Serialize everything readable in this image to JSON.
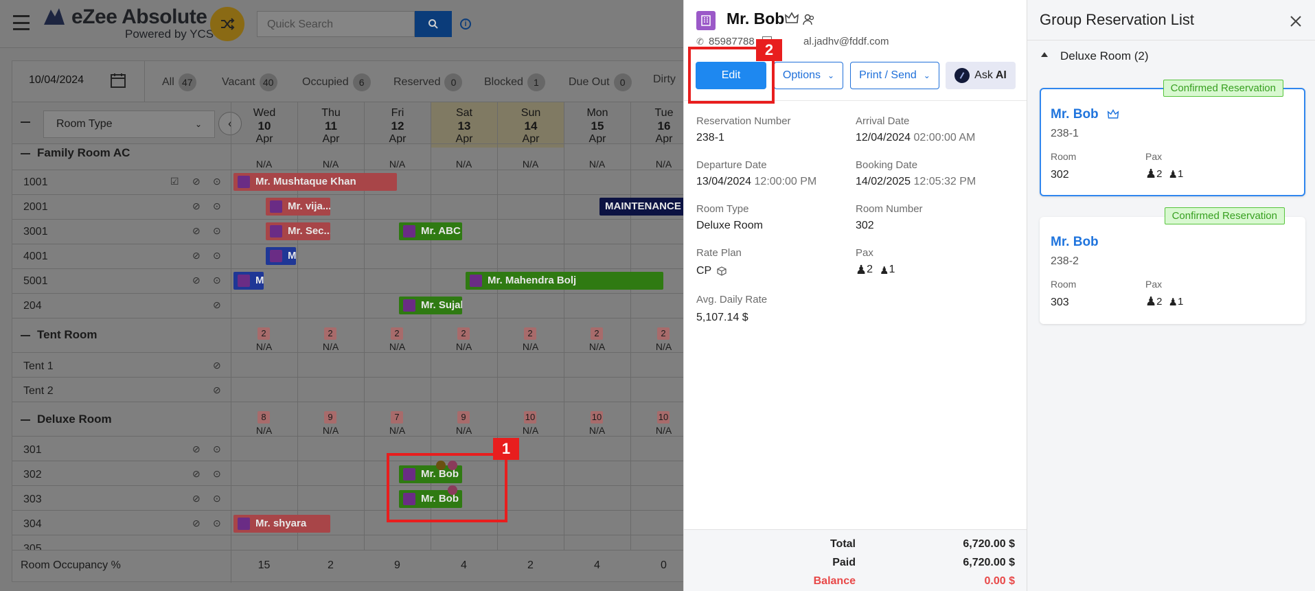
{
  "app": {
    "logo_text": "eZee Absolute",
    "logo_sub": "Powered by YCS",
    "search_placeholder": "Quick Search"
  },
  "filters": {
    "date": "10/04/2024",
    "items": [
      {
        "label": "All",
        "count": "47"
      },
      {
        "label": "Vacant",
        "count": "40"
      },
      {
        "label": "Occupied",
        "count": "6"
      },
      {
        "label": "Reserved",
        "count": "0"
      },
      {
        "label": "Blocked",
        "count": "1"
      },
      {
        "label": "Due Out",
        "count": "0"
      },
      {
        "label": "Dirty",
        "count": ""
      }
    ]
  },
  "grid": {
    "room_type_select": "Room Type",
    "days": [
      {
        "dow": "Wed",
        "day": "10",
        "mon": "Apr"
      },
      {
        "dow": "Thu",
        "day": "11",
        "mon": "Apr"
      },
      {
        "dow": "Fri",
        "day": "12",
        "mon": "Apr"
      },
      {
        "dow": "Sat",
        "day": "13",
        "mon": "Apr"
      },
      {
        "dow": "Sun",
        "day": "14",
        "mon": "Apr"
      },
      {
        "dow": "Mon",
        "day": "15",
        "mon": "Apr"
      },
      {
        "dow": "Tue",
        "day": "16",
        "mon": "Apr"
      }
    ],
    "groups": {
      "family": "Family Room AC",
      "tent": "Tent Room",
      "deluxe": "Deluxe Room"
    },
    "na": "N/A",
    "tent_counts": [
      "2",
      "2",
      "2",
      "2",
      "2",
      "2",
      "2"
    ],
    "deluxe_counts": [
      "8",
      "9",
      "7",
      "9",
      "10",
      "10",
      "10"
    ],
    "rooms": {
      "r1001": "1001",
      "r2001": "2001",
      "r3001": "3001",
      "r4001": "4001",
      "r5001": "5001",
      "r204": "204",
      "tent1": "Tent 1",
      "tent2": "Tent 2",
      "r301": "301",
      "r302": "302",
      "r303": "303",
      "r304": "304",
      "r305": "305"
    },
    "bookings": {
      "b1": "Mr. Mushtaque Khan",
      "b2": "Mr. vija...",
      "b3": "Mr. Sec...",
      "b4": "Mr. ABC",
      "b5": "M",
      "b6": "M",
      "b7": "Mr. Mahendra Bolj",
      "b8": "Mr. Sujal",
      "b9": "MAINTENANCE B",
      "b10": "Mr. Bob",
      "b11": "Mr. Bob",
      "b12": "Mr. shyara"
    },
    "occupancy_label": "Room Occupancy %",
    "occupancy": [
      "15",
      "2",
      "9",
      "4",
      "2",
      "4",
      "0"
    ]
  },
  "detail": {
    "guest_name": "Mr. Bob",
    "phone": "85987788",
    "email": "al.jadhv@fddf.com",
    "buttons": {
      "edit": "Edit",
      "options": "Options",
      "print": "Print / Send",
      "ask": "Ask",
      "ai": "AI"
    },
    "fields": {
      "res_no_label": "Reservation Number",
      "res_no": "238-1",
      "arrival_label": "Arrival Date",
      "arrival_date": "12/04/2024",
      "arrival_time": "02:00:00 AM",
      "departure_label": "Departure Date",
      "departure_date": "13/04/2024",
      "departure_time": "12:00:00 PM",
      "booking_label": "Booking Date",
      "booking_date": "14/02/2025",
      "booking_time": "12:05:32 PM",
      "room_type_label": "Room Type",
      "room_type": "Deluxe Room",
      "room_no_label": "Room Number",
      "room_no": "302",
      "rate_plan_label": "Rate Plan",
      "rate_plan": "CP",
      "pax_label": "Pax",
      "pax_adult": "2",
      "pax_child": "1",
      "adr_label": "Avg. Daily Rate",
      "adr": "5,107.14 $"
    },
    "totals": {
      "total_label": "Total",
      "total": "6,720.00 $",
      "paid_label": "Paid",
      "paid": "6,720.00 $",
      "balance_label": "Balance",
      "balance": "0.00 $"
    }
  },
  "group_list": {
    "title": "Group Reservation List",
    "section": "Deluxe Room (2)",
    "cards": [
      {
        "badge": "Confirmed Reservation",
        "name": "Mr. Bob",
        "res": "238-1",
        "room_label": "Room",
        "room": "302",
        "pax_label": "Pax",
        "adult": "2",
        "child": "1"
      },
      {
        "badge": "Confirmed Reservation",
        "name": "Mr. Bob",
        "res": "238-2",
        "room_label": "Room",
        "room": "303",
        "pax_label": "Pax",
        "adult": "2",
        "child": "1"
      }
    ]
  },
  "annotations": {
    "n1": "1",
    "n2": "2"
  }
}
